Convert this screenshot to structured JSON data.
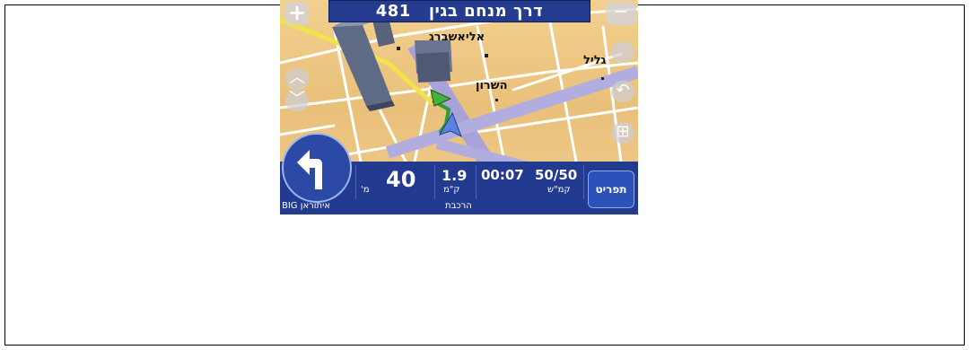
{
  "navigation": {
    "street_number": "481",
    "street_name": "דרך מנחם בגין",
    "map_labels": {
      "eliashberg": "אליאשברג",
      "hasharon": "השרון",
      "galil": "גליל"
    },
    "speed": "40",
    "speed_unit": "מ'",
    "distance": "1.9",
    "distance_unit": "ק\"מ",
    "time_remaining": "00:07",
    "speed_limit": "50/50",
    "speed_limit_unit": "קמ\"ש",
    "menu_label": "תפריט",
    "footer_left": "איתוראן BIG",
    "footer_mode": "הרכבת"
  },
  "controls": {
    "zoom_in": "+",
    "zoom_out": "−"
  },
  "colors": {
    "bar_blue": "#243b8f",
    "map_tan": "#e9c07a",
    "route_purple": "#a7a0d8",
    "route_green": "#2e9c2e",
    "road_yellow": "#f2ec54"
  }
}
